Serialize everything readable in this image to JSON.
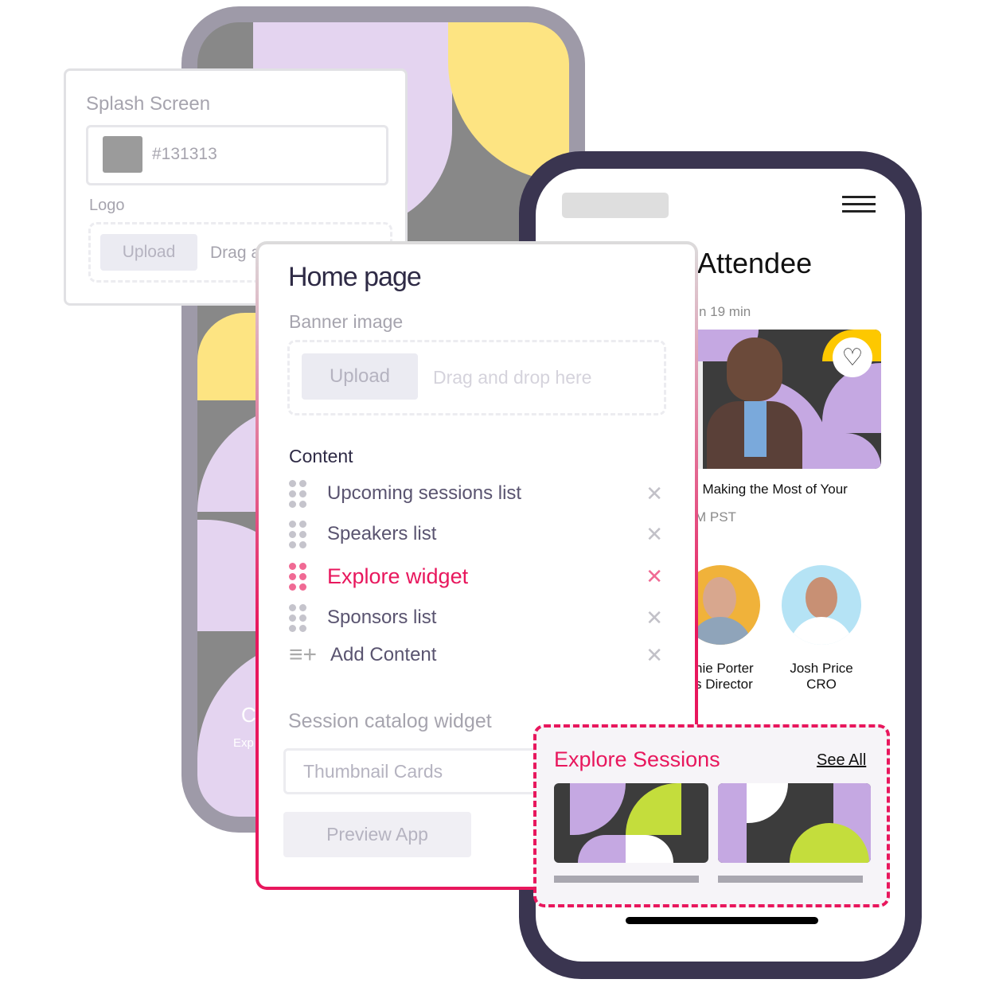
{
  "splash": {
    "title": "Splash Screen",
    "color_value": "#131313",
    "swatch_color": "#9b9b9b",
    "logo_label": "Logo",
    "upload": "Upload",
    "drag": "Drag and drop here"
  },
  "attendee": {
    "title": "Attendee",
    "starts": "n 19 min",
    "session_title": ": Making the Most of Your",
    "session_time": "M PST",
    "speakers": [
      {
        "name": "hie Porter",
        "role": "s Director"
      },
      {
        "name": "Josh Price",
        "role": "CRO"
      }
    ],
    "back_label": "C",
    "back_sub": "Exp"
  },
  "home": {
    "title": "Home page",
    "banner_label": "Banner image",
    "upload": "Upload",
    "drag": "Drag and drop here",
    "content_label": "Content",
    "items": [
      {
        "label": "Upcoming sessions list"
      },
      {
        "label": "Speakers list"
      },
      {
        "label": "Explore widget"
      },
      {
        "label": "Sponsors list"
      }
    ],
    "add_content": "Add Content",
    "catalog_label": "Session catalog widget",
    "catalog_value": "Thumbnail Cards",
    "preview": "Preview App"
  },
  "explore": {
    "title": "Explore Sessions",
    "see_all": "See All"
  },
  "colors": {
    "accent": "#e8175d",
    "frame_dark": "#3a3550",
    "frame_light": "#9e9aa8",
    "lavender": "#c5a8e2",
    "yellow": "#fde482",
    "lime": "#c4dd3c"
  }
}
